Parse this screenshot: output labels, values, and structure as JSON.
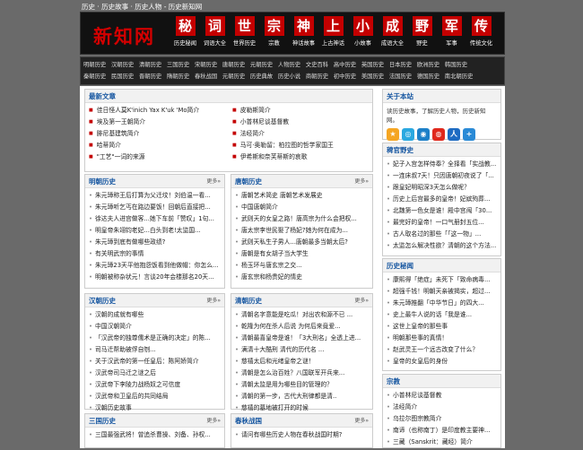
{
  "breadcrumb": "历史 · 历史故事 · 历史人物 - 历史新知网",
  "logo": "新知网",
  "topnav": [
    {
      "char": "秘",
      "label": "历史秘闻"
    },
    {
      "char": "词",
      "label": "词语大全"
    },
    {
      "char": "世",
      "label": "世界历史"
    },
    {
      "char": "宗",
      "label": "宗教"
    },
    {
      "char": "神",
      "label": "神话故事"
    },
    {
      "char": "上",
      "label": "上古神话"
    },
    {
      "char": "小",
      "label": "小故事"
    },
    {
      "char": "成",
      "label": "成语大全"
    },
    {
      "char": "野",
      "label": "野史"
    },
    {
      "char": "军",
      "label": "军事"
    },
    {
      "char": "传",
      "label": "传统文化"
    }
  ],
  "subnav_rows": [
    [
      "明朝历史",
      "汉朝历史",
      "清朝历史",
      "三国历史",
      "宋朝历史",
      "唐朝历史",
      "元朝历史",
      "人物历史",
      "文史百科",
      "高中历史",
      "英国历史",
      "日本历史",
      "欧洲历史",
      "韩国历史"
    ],
    [
      "秦朝历史",
      "民国历史",
      "晋朝历史",
      "隋朝历史",
      "春秋战国",
      "元朝历史",
      "历史典故",
      "历史小说",
      "商朝历史",
      "初中历史",
      "美国历史",
      "法国历史",
      "德国历史",
      "南北朝历史"
    ]
  ],
  "latest": {
    "title": "最新文章",
    "left": [
      "佳日怪人莫K'inich Yax K'uk 'Mo简介",
      "埃及第一王朝简介",
      "腓尼基建筑简介",
      "哈蒂简介",
      "\"工艺\"一词的来源"
    ],
    "right": [
      "皮勒斯简介",
      "小普林尼谈基督教",
      "法经简介",
      "马可·奥勒留：柏拉图的哲学家国王",
      "伊希斯和奈芙蒂斯的哀歌"
    ]
  },
  "ming": {
    "title": "明朝历史",
    "more": "更多»",
    "items": [
      "朱元璋称王后打算为父迁坟！刘伯温一看...",
      "朱元璋听乞丐在路边要饭！回朝后直接把...",
      "徐达夫人进宫做客...她下车前「赞叹」1句...",
      "明皇帝朱翊钧老妃...白头到老!太监国...",
      "朱元璋到底有做哪些政绩?",
      "有关明武宗的事情",
      "朱元璋23天平他抱怨饭看到他做帽：你怎么...",
      "明朝被称杂状元！言谈20年会楼那名20天..."
    ]
  },
  "tang": {
    "title": "唐朝历史",
    "more": "更多»",
    "items": [
      "唐朝艺术简史 唐朝艺术发展史",
      "中国唐朝简介",
      "武则天的女皇之路！唐高宗为什么会把权...",
      "唐太宗李世民娶了杨妃?她为何在成为...",
      "武则天私生子男人...唐朝最多当朝太后?",
      "唐朝是有女胡子当大学生",
      "杨玉环与唐玄宗之交...",
      "唐玄宗和杨贵妃的情史",
      "唐太宗李渊退位！李世民邓来于管..."
    ]
  },
  "han": {
    "title": "汉朝历史",
    "more": "更多»",
    "items": [
      "汉朝的成就有哪些",
      "中国汉朝简介",
      "「汉武帝的独尊儒术是正确的决定」的陈...",
      "司马迁帮助被俘自刎...",
      "关于汉武帝的第一任皇后：陈阿娇简介",
      "汉武帝司马迁之谜之后",
      "汉武帝下李陵力战杨奴之可信度",
      "汉武帝和卫皇后的共同结局",
      "汉朝历史故事"
    ]
  },
  "qing": {
    "title": "清朝历史",
    "more": "更多»",
    "items": [
      "清朝名字意能是吃瓜！对出农和源不已 ...",
      "乾隆为何在杀人后说 为何后来竟爱...",
      "清朝最喜皇帝是谁！「3大刑名」全透上进...",
      "满清十大酷刑 清代的历代名 ...",
      "慈禧太后和光绪皇帝之谜！",
      "清朝是怎么治百姓？八国联军开兵来...",
      "清朝太监是用为哪些目的管理的？",
      "清朝的第一步，古代大刑律都是清..",
      "慈禧的墓地被打开的时候"
    ]
  },
  "sanguo": {
    "title": "三国历史",
    "more": "更多»",
    "items": [
      "三国最强武将！曾追杀曹操、刘备、孙权..."
    ]
  },
  "chunqiu": {
    "title": "春秋战国",
    "more": "更多»",
    "items": [
      "请问有哪些历史人物在春秋战国时期?"
    ]
  },
  "about": {
    "title": "关于本站",
    "text": "读历史故事，了解历史人物，历史新知网。"
  },
  "share_icons": [
    {
      "name": "qzone-icon",
      "glyph": "★",
      "color": "#f5a623"
    },
    {
      "name": "wechat-icon",
      "glyph": "◎",
      "color": "#2aa8e0"
    },
    {
      "name": "tencent-icon",
      "glyph": "◉",
      "color": "#1d80c8"
    },
    {
      "name": "weibo-icon",
      "glyph": "◍",
      "color": "#e0281c"
    },
    {
      "name": "renren-icon",
      "glyph": "人",
      "color": "#1d6bc2"
    },
    {
      "name": "more-icon",
      "glyph": "+",
      "color": "#2a8ad6"
    }
  ],
  "yeshi": {
    "title": "稗官野史",
    "items": [
      "妃子入宫怎样侍奉？全择看「实战教...",
      "一连床叔7天！只因唐朝初夜说了「...",
      "跟皇妃明昭深3天怎么做呢？",
      "历史上后宫最多的皇帝！妃嫔殉葬...",
      "北魏第一色女是谁！殿中宫闱「30...",
      "最完好的皇帝！一口气册封五位...",
      "古人取名过的那些「「这一物」...",
      "太监怎么解决性欲？清朝的这个方法..."
    ]
  },
  "mimi": {
    "title": "历史秘闻",
    "items": [
      "康熙得「绝症」未死下「致命病毒...",
      "超强千钱！明朝天亲被揭实，超过...",
      "朱元璋推翻「中华节日」的四大...",
      "史上最牛人说的话「我是谁...",
      "这世上皇帝的那些事",
      "明朝那些事的真情！",
      "赵武灵王一个远古改变了什么？",
      "皇帝的女皇后的身份"
    ]
  },
  "zongjiao": {
    "title": "宗教",
    "items": [
      "小普林尼谈基督教",
      "法经简介",
      "乌拉尔图宗教简介",
      "南谛（也称南丁）是印度教主要神...",
      "三藏（Sanskrit：藏经）简介"
    ]
  }
}
